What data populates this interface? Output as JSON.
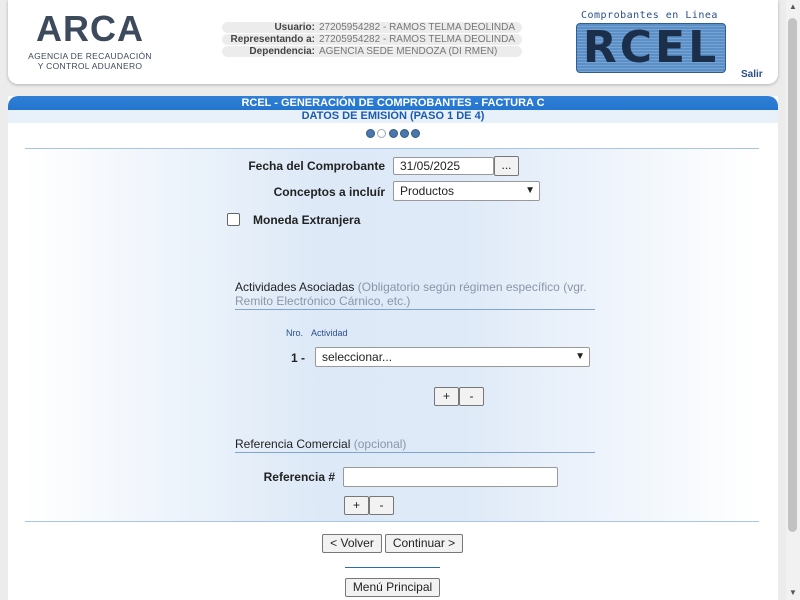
{
  "header": {
    "logo": {
      "name": "ARCA",
      "subtitle_line1": "AGENCIA DE RECAUDACIÓN",
      "subtitle_line2": "Y CONTROL ADUANERO"
    },
    "user_info": [
      {
        "label": "Usuario:",
        "value": "27205954282 - RAMOS TELMA DEOLINDA"
      },
      {
        "label": "Representando a:",
        "value": "27205954282 - RAMOS TELMA DEOLINDA"
      },
      {
        "label": "Dependencia:",
        "value": "AGENCIA SEDE MENDOZA (DI RMEN)"
      }
    ],
    "rcel_caption": "Comprobantes en Linea",
    "rcel_word": "RCEL",
    "logout_label": "Salir"
  },
  "title": {
    "line1": "RCEL - GENERACIÓN DE COMPROBANTES - FACTURA C",
    "line2": "DATOS DE EMISIÓN (PASO 1 DE 4)"
  },
  "form": {
    "fecha_label": "Fecha del Comprobante",
    "fecha_value": "31/05/2025",
    "calendar_button": "...",
    "conceptos_label": "Conceptos a incluír",
    "conceptos_value": "Productos",
    "moneda_label": "Moneda Extranjera",
    "actividades_title": "Actividades Asociadas",
    "actividades_hint": "(Obligatorio según régimen específico (vgr. Remito Electrónico Cárnico, etc.)",
    "col_nro": "Nro.",
    "col_actividad": "Actividad",
    "row_number": "1 -",
    "actividad_value": "seleccionar...",
    "add_label": "+",
    "remove_label": "-",
    "referencia_title": "Referencia Comercial",
    "referencia_hint": "(opcional)",
    "referencia_label": "Referencia #",
    "referencia_value": ""
  },
  "buttons": {
    "back": "< Volver",
    "continue": "Continuar >",
    "main_menu": "Menú Principal"
  },
  "steps": {
    "current": 2,
    "total": 5
  }
}
